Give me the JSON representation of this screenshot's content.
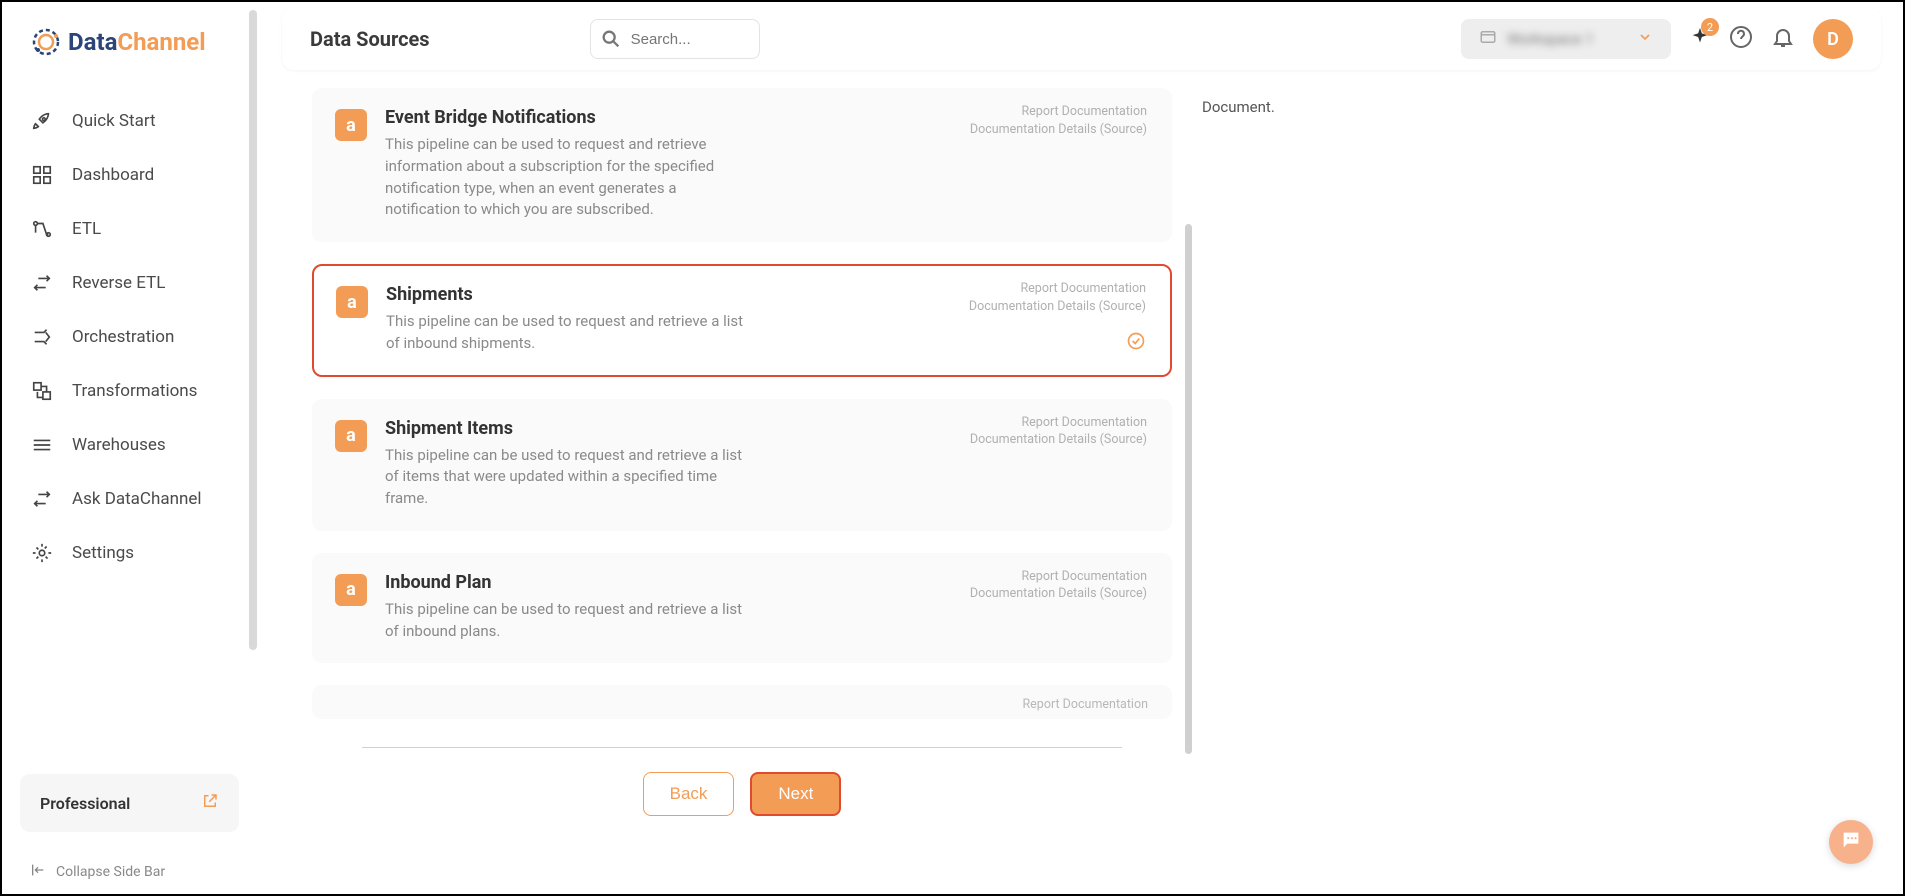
{
  "brand": {
    "name1": "Data",
    "name2": "Channel"
  },
  "sidebar": {
    "items": [
      {
        "label": "Quick Start"
      },
      {
        "label": "Dashboard"
      },
      {
        "label": "ETL"
      },
      {
        "label": "Reverse ETL"
      },
      {
        "label": "Orchestration"
      },
      {
        "label": "Transformations"
      },
      {
        "label": "Warehouses"
      },
      {
        "label": "Ask DataChannel"
      },
      {
        "label": "Settings"
      }
    ],
    "plan_label": "Professional",
    "collapse_label": "Collapse Side Bar"
  },
  "header": {
    "title": "Data Sources",
    "search_placeholder": "Search...",
    "workspace_label": "Workspace 1",
    "badge_count": "2",
    "avatar_letter": "D"
  },
  "cards": [
    {
      "title": "Event Bridge Notifications",
      "desc": "This pipeline can be used to request and retrieve information about a subscription for the specified notification type, when an event generates a notification to which you are subscribed.",
      "link1": "Report Documentation",
      "link2": "Documentation Details (Source)"
    },
    {
      "title": "Shipments",
      "desc": "This pipeline can be used to request and retrieve a list of inbound shipments.",
      "link1": "Report Documentation",
      "link2": "Documentation Details (Source)"
    },
    {
      "title": "Shipment Items",
      "desc": "This pipeline can be used to request and retrieve a list of items that were updated within a specified time frame.",
      "link1": "Report Documentation",
      "link2": "Documentation Details (Source)"
    },
    {
      "title": "Inbound Plan",
      "desc": "This pipeline can be used to request and retrieve a list of inbound plans.",
      "link1": "Report Documentation",
      "link2": "Documentation Details (Source)"
    }
  ],
  "peek": {
    "link1": "Report Documentation"
  },
  "right": {
    "text": "Document."
  },
  "footer": {
    "back": "Back",
    "next": "Next"
  }
}
